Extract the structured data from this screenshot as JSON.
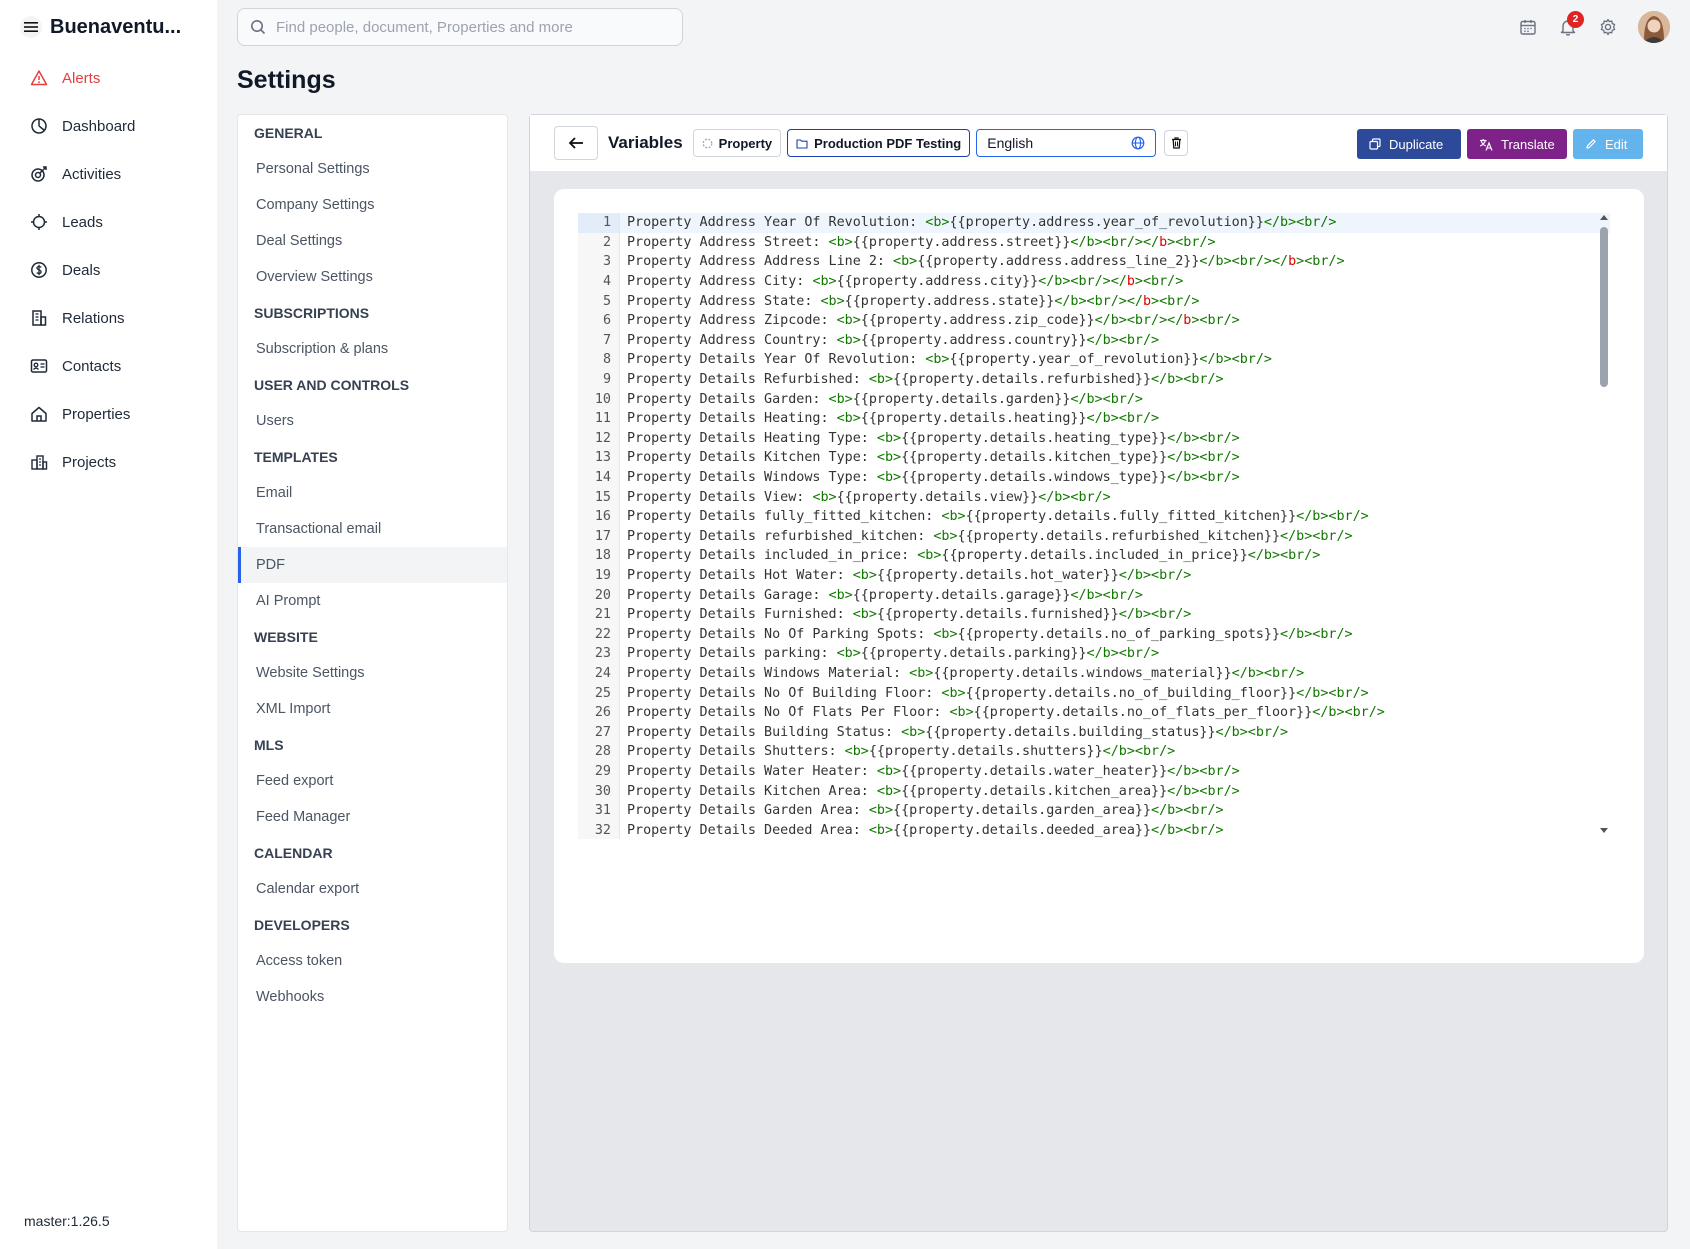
{
  "app": {
    "brand": "Buenaventu...",
    "version": "master:1.26.5"
  },
  "search": {
    "placeholder": "Find people, document, Properties and more"
  },
  "notifications": {
    "count": "2"
  },
  "nav": [
    {
      "label": "Alerts",
      "icon": "alert-triangle-icon",
      "active": true
    },
    {
      "label": "Dashboard",
      "icon": "dashboard-icon"
    },
    {
      "label": "Activities",
      "icon": "activities-icon"
    },
    {
      "label": "Leads",
      "icon": "leads-icon"
    },
    {
      "label": "Deals",
      "icon": "dollar-icon"
    },
    {
      "label": "Relations",
      "icon": "building-icon"
    },
    {
      "label": "Contacts",
      "icon": "contact-card-icon"
    },
    {
      "label": "Properties",
      "icon": "home-icon"
    },
    {
      "label": "Projects",
      "icon": "projects-icon"
    }
  ],
  "page": {
    "title": "Settings"
  },
  "settings_nav": [
    {
      "type": "section",
      "label": "GENERAL"
    },
    {
      "type": "item",
      "label": "Personal Settings"
    },
    {
      "type": "item",
      "label": "Company Settings"
    },
    {
      "type": "item",
      "label": "Deal Settings"
    },
    {
      "type": "item",
      "label": "Overview Settings"
    },
    {
      "type": "section",
      "label": "SUBSCRIPTIONS"
    },
    {
      "type": "item",
      "label": "Subscription & plans"
    },
    {
      "type": "section",
      "label": "USER AND CONTROLS"
    },
    {
      "type": "item",
      "label": "Users"
    },
    {
      "type": "section",
      "label": "TEMPLATES"
    },
    {
      "type": "item",
      "label": "Email"
    },
    {
      "type": "item",
      "label": "Transactional email"
    },
    {
      "type": "item",
      "label": "PDF",
      "active": true
    },
    {
      "type": "item",
      "label": "AI Prompt"
    },
    {
      "type": "section",
      "label": "WEBSITE"
    },
    {
      "type": "item",
      "label": "Website Settings"
    },
    {
      "type": "item",
      "label": "XML Import"
    },
    {
      "type": "section",
      "label": "MLS"
    },
    {
      "type": "item",
      "label": "Feed export"
    },
    {
      "type": "item",
      "label": "Feed Manager"
    },
    {
      "type": "section",
      "label": "CALENDAR"
    },
    {
      "type": "item",
      "label": "Calendar export"
    },
    {
      "type": "section",
      "label": "DEVELOPERS"
    },
    {
      "type": "item",
      "label": "Access token"
    },
    {
      "type": "item",
      "label": "Webhooks"
    }
  ],
  "toolbar": {
    "title": "Variables",
    "entity_chip": "Property",
    "template_chip": "Production PDF Testing",
    "language": "English",
    "duplicate_label": "Duplicate",
    "translate_label": "Translate",
    "edit_label": "Edit"
  },
  "colors": {
    "alert": "#e53e3e",
    "duplicate": "#2d4a9a",
    "translate": "#7e2188",
    "edit": "#63b3ed"
  },
  "code_lines": [
    "Property Address Year Of Revolution: <b>{{property.address.year_of_revolution}}</b><br/>",
    "Property Address Street: <b>{{property.address.street}}</b><br/></b><br/>",
    "Property Address Address Line 2: <b>{{property.address.address_line_2}}</b><br/></b><br/>",
    "Property Address City: <b>{{property.address.city}}</b><br/></b><br/>",
    "Property Address State: <b>{{property.address.state}}</b><br/></b><br/>",
    "Property Address Zipcode: <b>{{property.address.zip_code}}</b><br/></b><br/>",
    "Property Address Country: <b>{{property.address.country}}</b><br/>",
    "Property Details Year Of Revolution: <b>{{property.year_of_revolution}}</b><br/>",
    "Property Details Refurbished: <b>{{property.details.refurbished}}</b><br/>",
    "Property Details Garden: <b>{{property.details.garden}}</b><br/>",
    "Property Details Heating: <b>{{property.details.heating}}</b><br/>",
    "Property Details Heating Type: <b>{{property.details.heating_type}}</b><br/>",
    "Property Details Kitchen Type: <b>{{property.details.kitchen_type}}</b><br/>",
    "Property Details Windows Type: <b>{{property.details.windows_type}}</b><br/>",
    "Property Details View: <b>{{property.details.view}}</b><br/>",
    "Property Details fully_fitted_kitchen: <b>{{property.details.fully_fitted_kitchen}}</b><br/>",
    "Property Details refurbished_kitchen: <b>{{property.details.refurbished_kitchen}}</b><br/>",
    "Property Details included_in_price: <b>{{property.details.included_in_price}}</b><br/>",
    "Property Details Hot Water: <b>{{property.details.hot_water}}</b><br/>",
    "Property Details Garage: <b>{{property.details.garage}}</b><br/>",
    "Property Details Furnished: <b>{{property.details.furnished}}</b><br/>",
    "Property Details No Of Parking Spots: <b>{{property.details.no_of_parking_spots}}</b><br/>",
    "Property Details parking: <b>{{property.details.parking}}</b><br/>",
    "Property Details Windows Material: <b>{{property.details.windows_material}}</b><br/>",
    "Property Details No Of Building Floor: <b>{{property.details.no_of_building_floor}}</b><br/>",
    "Property Details No Of Flats Per Floor: <b>{{property.details.no_of_flats_per_floor}}</b><br/>",
    "Property Details Building Status: <b>{{property.details.building_status}}</b><br/>",
    "Property Details Shutters: <b>{{property.details.shutters}}</b><br/>",
    "Property Details Water Heater: <b>{{property.details.water_heater}}</b><br/>",
    "Property Details Kitchen Area: <b>{{property.details.kitchen_area}}</b><br/>",
    "Property Details Garden Area: <b>{{property.details.garden_area}}</b><br/>",
    "Property Details Deeded Area: <b>{{property.details.deeded_area}}</b><br/>"
  ]
}
